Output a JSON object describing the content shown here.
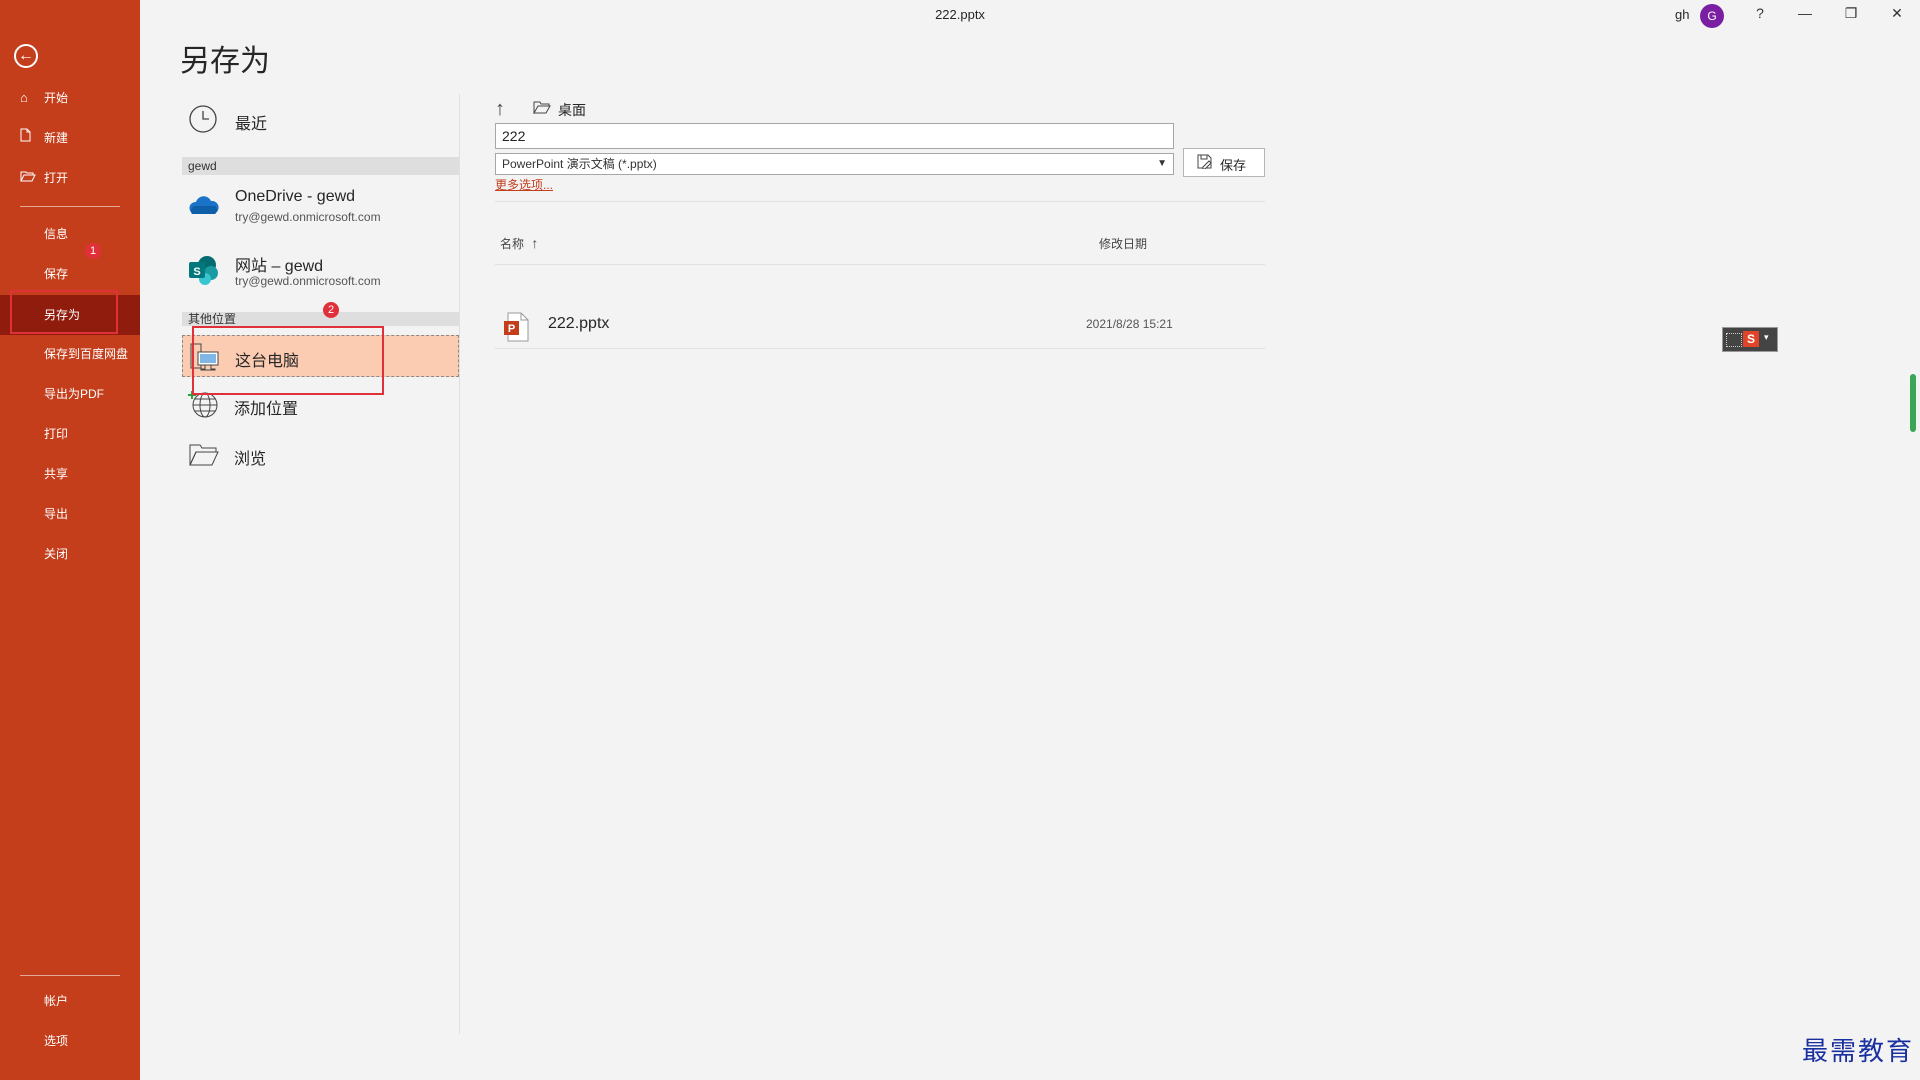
{
  "window": {
    "title": "222.pptx",
    "user_name": "gh",
    "avatar_letter": "G",
    "help_label": "?",
    "minimize_label": "—",
    "restore_label": "❐",
    "close_label": "✕"
  },
  "nav": {
    "back_label": "←",
    "items": [
      {
        "label": "开始",
        "icon": "home-icon"
      },
      {
        "label": "新建",
        "icon": "new-file-icon"
      },
      {
        "label": "打开",
        "icon": "open-folder-icon"
      },
      {
        "label": "信息"
      },
      {
        "label": "保存"
      },
      {
        "label": "另存为",
        "selected": true
      },
      {
        "label": "保存到百度网盘"
      },
      {
        "label": "导出为PDF"
      },
      {
        "label": "打印"
      },
      {
        "label": "共享"
      },
      {
        "label": "导出"
      },
      {
        "label": "关闭"
      },
      {
        "label": "帐户"
      },
      {
        "label": "选项"
      }
    ]
  },
  "page": {
    "title": "另存为"
  },
  "places": {
    "recent": {
      "label": "最近"
    },
    "group_gewd": "gewd",
    "onedrive": {
      "title": "OneDrive - gewd",
      "sub": "try@gewd.onmicrosoft.com"
    },
    "sharepoint": {
      "title": "网站 – gewd",
      "sub": "try@gewd.onmicrosoft.com"
    },
    "group_other": "其他位置",
    "this_pc": {
      "label": "这台电脑",
      "selected": true
    },
    "add_place": {
      "label": "添加位置"
    },
    "browse": {
      "label": "浏览"
    }
  },
  "pane": {
    "breadcrumb": "桌面",
    "filename_value": "222",
    "filetype_value": "PowerPoint 演示文稿 (*.pptx)",
    "save_label": "保存",
    "more_options": "更多选项...",
    "col_name": "名称",
    "col_modified": "修改日期",
    "files": [
      {
        "name": "222.pptx",
        "modified": "2021/8/28 15:21"
      }
    ]
  },
  "annotations": {
    "badge1": "1",
    "badge2": "2"
  },
  "ime": {
    "label": "S"
  },
  "watermark": "最需教育",
  "colors": {
    "accent": "#c43e1c",
    "nav_selected": "#8f1c0d",
    "place_selected": "#fbcbb2",
    "annotation_red": "#e0303a"
  }
}
